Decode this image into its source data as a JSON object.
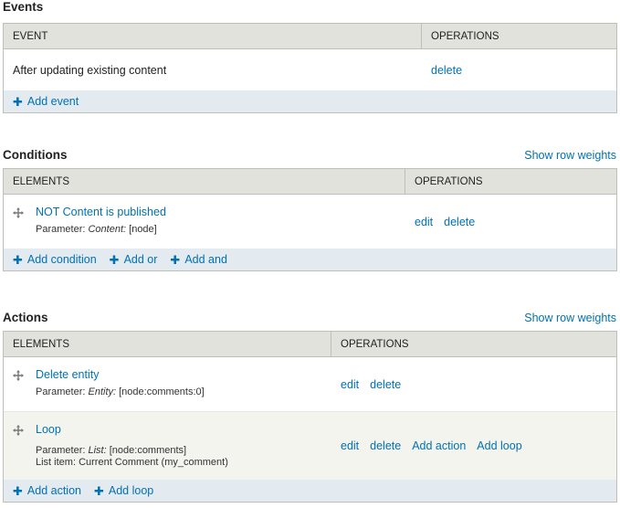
{
  "events": {
    "title": "Events",
    "col_event": "EVENT",
    "col_operations": "OPERATIONS",
    "row_label": "After updating existing content",
    "row_delete": "delete",
    "add_event": "Add event"
  },
  "conditions": {
    "title": "Conditions",
    "show_row_weights": "Show row weights",
    "col_elements": "ELEMENTS",
    "col_operations": "OPERATIONS",
    "row": {
      "label": "NOT Content is published",
      "param_prefix": "Parameter:",
      "param_name": "Content:",
      "param_value": "[node]",
      "edit": "edit",
      "delete": "delete"
    },
    "add_condition": "Add condition",
    "add_or": "Add or",
    "add_and": "Add and"
  },
  "actions": {
    "title": "Actions",
    "show_row_weights": "Show row weights",
    "col_elements": "ELEMENTS",
    "col_operations": "OPERATIONS",
    "rows": [
      {
        "label": "Delete entity",
        "param_prefix": "Parameter:",
        "param_name": "Entity:",
        "param_value": "[node:comments:0]",
        "edit": "edit",
        "delete": "delete"
      },
      {
        "label": "Loop",
        "param_prefix": "Parameter:",
        "param_name": "List:",
        "param_value": "[node:comments]",
        "list_item": "List item: Current Comment (my_comment)",
        "edit": "edit",
        "delete": "delete",
        "add_action": "Add action",
        "add_loop": "Add loop"
      }
    ],
    "add_action": "Add action",
    "add_loop": "Add loop"
  }
}
